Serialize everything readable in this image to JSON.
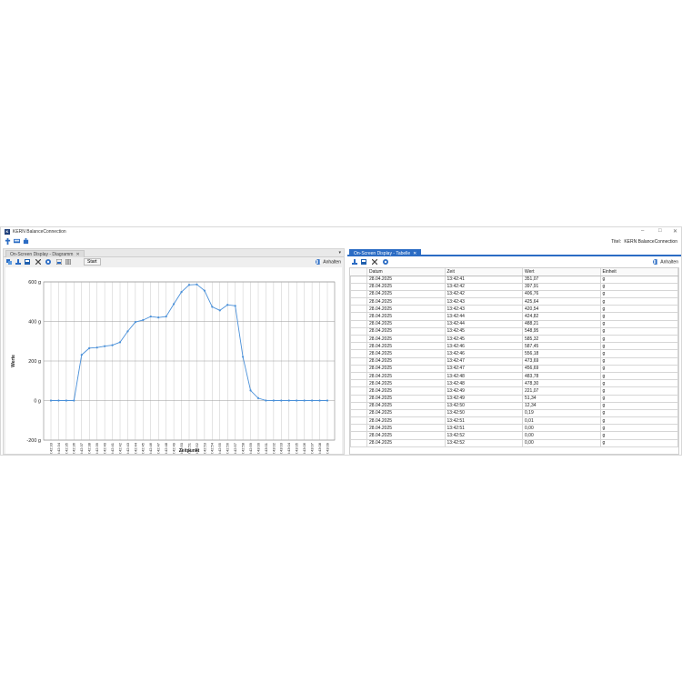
{
  "app": {
    "logo_letter": "K",
    "title": "KERN BalanceConnection",
    "titel_label": "Titel:",
    "titel_value": "KERN BalanceConnection"
  },
  "left_tab": {
    "label": "On-Screen Display - Diagramm",
    "close": "✕"
  },
  "right_tab": {
    "label": "On-Screen Display - Tabelle",
    "close": "✕"
  },
  "toolbar": {
    "start_label": "Start",
    "pause_label": "Anhalten"
  },
  "colors": {
    "accent": "#2b6cc4",
    "series": "#4a90d9",
    "grid": "#c8c8c8"
  },
  "chart_data": {
    "type": "line",
    "xlabel": "Zeitpunkt",
    "ylabel": "Werte",
    "ylim": [
      -200,
      600
    ],
    "yticks": [
      -200,
      0,
      200,
      400,
      600
    ],
    "ytick_labels": [
      "-200 g",
      "0 g",
      "200 g",
      "400 g",
      "600 g"
    ],
    "grid": true,
    "x": [
      "13:42:33",
      "13:42:34",
      "13:42:35",
      "13:42:36",
      "13:42:37",
      "13:42:38",
      "13:42:39",
      "13:42:40",
      "13:42:41",
      "13:42:42",
      "13:42:43",
      "13:42:44",
      "13:42:45",
      "13:42:46",
      "13:42:47",
      "13:42:48",
      "13:42:49",
      "13:42:50",
      "13:42:51",
      "13:42:52",
      "13:42:53",
      "13:42:54",
      "13:42:55",
      "13:42:56",
      "13:42:57",
      "13:42:58",
      "13:42:59",
      "13:43:00",
      "13:43:01",
      "13:43:02",
      "13:43:03",
      "13:43:04",
      "13:43:05",
      "13:43:06",
      "13:43:07",
      "13:43:08",
      "13:43:09"
    ],
    "series": [
      {
        "values": [
          0,
          0,
          0,
          0,
          231,
          265,
          268,
          275,
          280,
          295,
          350,
          397,
          407,
          425,
          420,
          425,
          488,
          549,
          585,
          587,
          556,
          474,
          456,
          484,
          479,
          221,
          51,
          12,
          0.19,
          0,
          0,
          0,
          0,
          0,
          0,
          0,
          0
        ]
      }
    ],
    "tick_labels": [
      "13:42:33",
      "13:42:34",
      "13:42:35",
      "13:42:36",
      "13:42:37",
      "13:42:38",
      "13:42:39",
      "13:42:40",
      "13:42:41",
      "13:42:42",
      "13:42:43",
      "13:42:44",
      "13:42:45",
      "13:42:46",
      "13:42:47",
      "13:42:48",
      "13:42:49",
      "13:42:50",
      "13:42:51",
      "13:42:52",
      "13:42:53",
      "13:42:54",
      "13:42:55",
      "13:42:56",
      "13:42:57",
      "13:42:58",
      "13:42:59",
      "13:43:00",
      "13:43:01",
      "13:43:02",
      "13:43:03",
      "13:43:04",
      "13:43:05",
      "13:43:06",
      "13:43:07",
      "13:43:08",
      "13:43:09"
    ]
  },
  "table": {
    "columns": [
      "Datum",
      "Zeit",
      "Wert",
      "Einheit"
    ],
    "rows": [
      [
        "28.04.2025",
        "13:42:41",
        "351,07",
        "g"
      ],
      [
        "28.04.2025",
        "13:42:42",
        "397,91",
        "g"
      ],
      [
        "28.04.2025",
        "13:42:42",
        "406,76",
        "g"
      ],
      [
        "28.04.2025",
        "13:42:43",
        "425,64",
        "g"
      ],
      [
        "28.04.2025",
        "13:42:43",
        "420,54",
        "g"
      ],
      [
        "28.04.2025",
        "13:42:44",
        "424,82",
        "g"
      ],
      [
        "28.04.2025",
        "13:42:44",
        "488,21",
        "g"
      ],
      [
        "28.04.2025",
        "13:42:45",
        "548,95",
        "g"
      ],
      [
        "28.04.2025",
        "13:42:45",
        "585,32",
        "g"
      ],
      [
        "28.04.2025",
        "13:42:46",
        "587,45",
        "g"
      ],
      [
        "28.04.2025",
        "13:42:46",
        "556,18",
        "g"
      ],
      [
        "28.04.2025",
        "13:42:47",
        "473,69",
        "g"
      ],
      [
        "28.04.2025",
        "13:42:47",
        "456,69",
        "g"
      ],
      [
        "28.04.2025",
        "13:42:48",
        "483,78",
        "g"
      ],
      [
        "28.04.2025",
        "13:42:48",
        "478,30",
        "g"
      ],
      [
        "28.04.2025",
        "13:42:49",
        "221,07",
        "g"
      ],
      [
        "28.04.2025",
        "13:42:49",
        "51,34",
        "g"
      ],
      [
        "28.04.2025",
        "13:42:50",
        "12,34",
        "g"
      ],
      [
        "28.04.2025",
        "13:42:50",
        "0,19",
        "g"
      ],
      [
        "28.04.2025",
        "13:42:51",
        "0,01",
        "g"
      ],
      [
        "28.04.2025",
        "13:42:51",
        "0,00",
        "g"
      ],
      [
        "28.04.2025",
        "13:42:52",
        "0,00",
        "g"
      ],
      [
        "28.04.2025",
        "13:42:52",
        "0,00",
        "g"
      ]
    ]
  }
}
